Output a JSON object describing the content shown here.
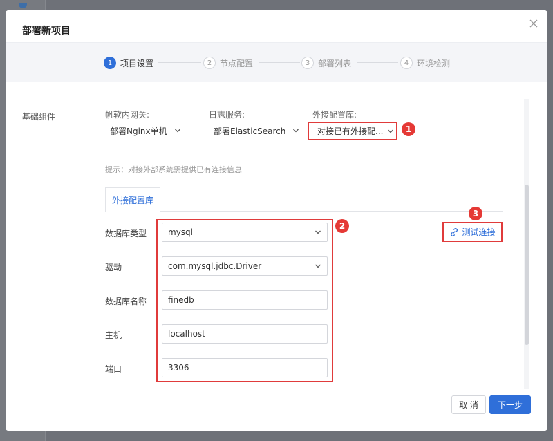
{
  "dialog": {
    "title": "部署新项目"
  },
  "steps": [
    {
      "number": "1",
      "label": "项目设置",
      "active": true
    },
    {
      "number": "2",
      "label": "节点配置",
      "active": false
    },
    {
      "number": "3",
      "label": "部署列表",
      "active": false
    },
    {
      "number": "4",
      "label": "环境检测",
      "active": false
    }
  ],
  "basic_components": {
    "section_label": "基础组件",
    "gateway": {
      "label": "帆软内网关:",
      "value": "部署Nginx单机"
    },
    "log_service": {
      "label": "日志服务:",
      "value": "部署ElasticSearch"
    },
    "external_config_db": {
      "label": "外接配置库:",
      "value": "对接已有外接配..."
    },
    "hint": "提示：对接外部系统需提供已有连接信息"
  },
  "tab": {
    "label": "外接配置库"
  },
  "db_form": {
    "db_type": {
      "label": "数据库类型",
      "value": "mysql"
    },
    "driver": {
      "label": "驱动",
      "value": "com.mysql.jdbc.Driver"
    },
    "db_name": {
      "label": "数据库名称",
      "value": "finedb"
    },
    "host": {
      "label": "主机",
      "value": "localhost"
    },
    "port": {
      "label": "端口",
      "value": "3306"
    }
  },
  "test_connection": {
    "label": "测试连接"
  },
  "annotations": [
    "1",
    "2",
    "3"
  ],
  "footer": {
    "cancel_label": "取 消",
    "next_label": "下一步"
  },
  "colors": {
    "primary": "#2f6fd9",
    "annotation_red": "#e53935",
    "highlight_border": "#e03b3b"
  }
}
